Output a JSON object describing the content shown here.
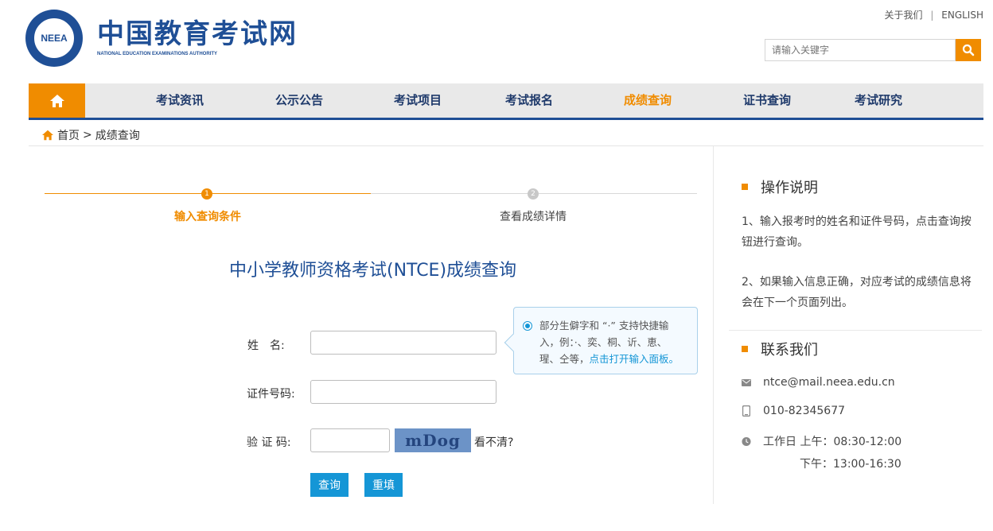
{
  "top_links": {
    "about": "关于我们",
    "separator": "|",
    "english": "ENGLISH"
  },
  "logo": {
    "emblem_text": "NEEA",
    "cn": "中国教育考试网",
    "en": "NATIONAL EDUCATION EXAMINATIONS AUTHORITY"
  },
  "search": {
    "placeholder": "请输入关键字",
    "icon": "search-icon"
  },
  "nav": {
    "home_icon": "home-icon",
    "items": [
      "考试资讯",
      "公示公告",
      "考试项目",
      "考试报名",
      "成绩查询",
      "证书查询",
      "考试研究"
    ],
    "active": "成绩查询"
  },
  "breadcrumb": {
    "home": "首页",
    "separator": ">",
    "current": "成绩查询"
  },
  "steps": [
    {
      "num": "1",
      "label": "输入查询条件",
      "active": true
    },
    {
      "num": "2",
      "label": "查看成绩详情",
      "active": false
    }
  ],
  "form": {
    "title": "中小学教师资格考试(NTCE)成绩查询",
    "name_label": "姓　名:",
    "id_label": "证件号码:",
    "captcha_label": "验 证 码:",
    "captcha_text": "mDog",
    "cant_see": "看不清?",
    "submit": "查询",
    "reset": "重填"
  },
  "tip": {
    "line1": "部分生僻字和 “·” 支持快捷输",
    "line2": "入，例：·、奕、桐、䜣、恵、",
    "line3_prefix": "瑆、仝等，",
    "line3_link": "点击打开输入面板。"
  },
  "sidebar": {
    "ops_title": "操作说明",
    "ops_p1": "1、输入报考时的姓名和证件号码，点击查询按钮进行查询。",
    "ops_p2": "2、如果输入信息正确，对应考试的成绩信息将会在下一个页面列出。",
    "contact_title": "联系我们",
    "email": "ntce@mail.neea.edu.cn",
    "phone": "010-82345677",
    "hours_am": "工作日 上午：08:30-12:00",
    "hours_pm": "下午：13:00-16:30"
  },
  "colors": {
    "brand_blue": "#1f4f96",
    "accent_orange": "#f08c00",
    "button_blue": "#1596d6"
  }
}
